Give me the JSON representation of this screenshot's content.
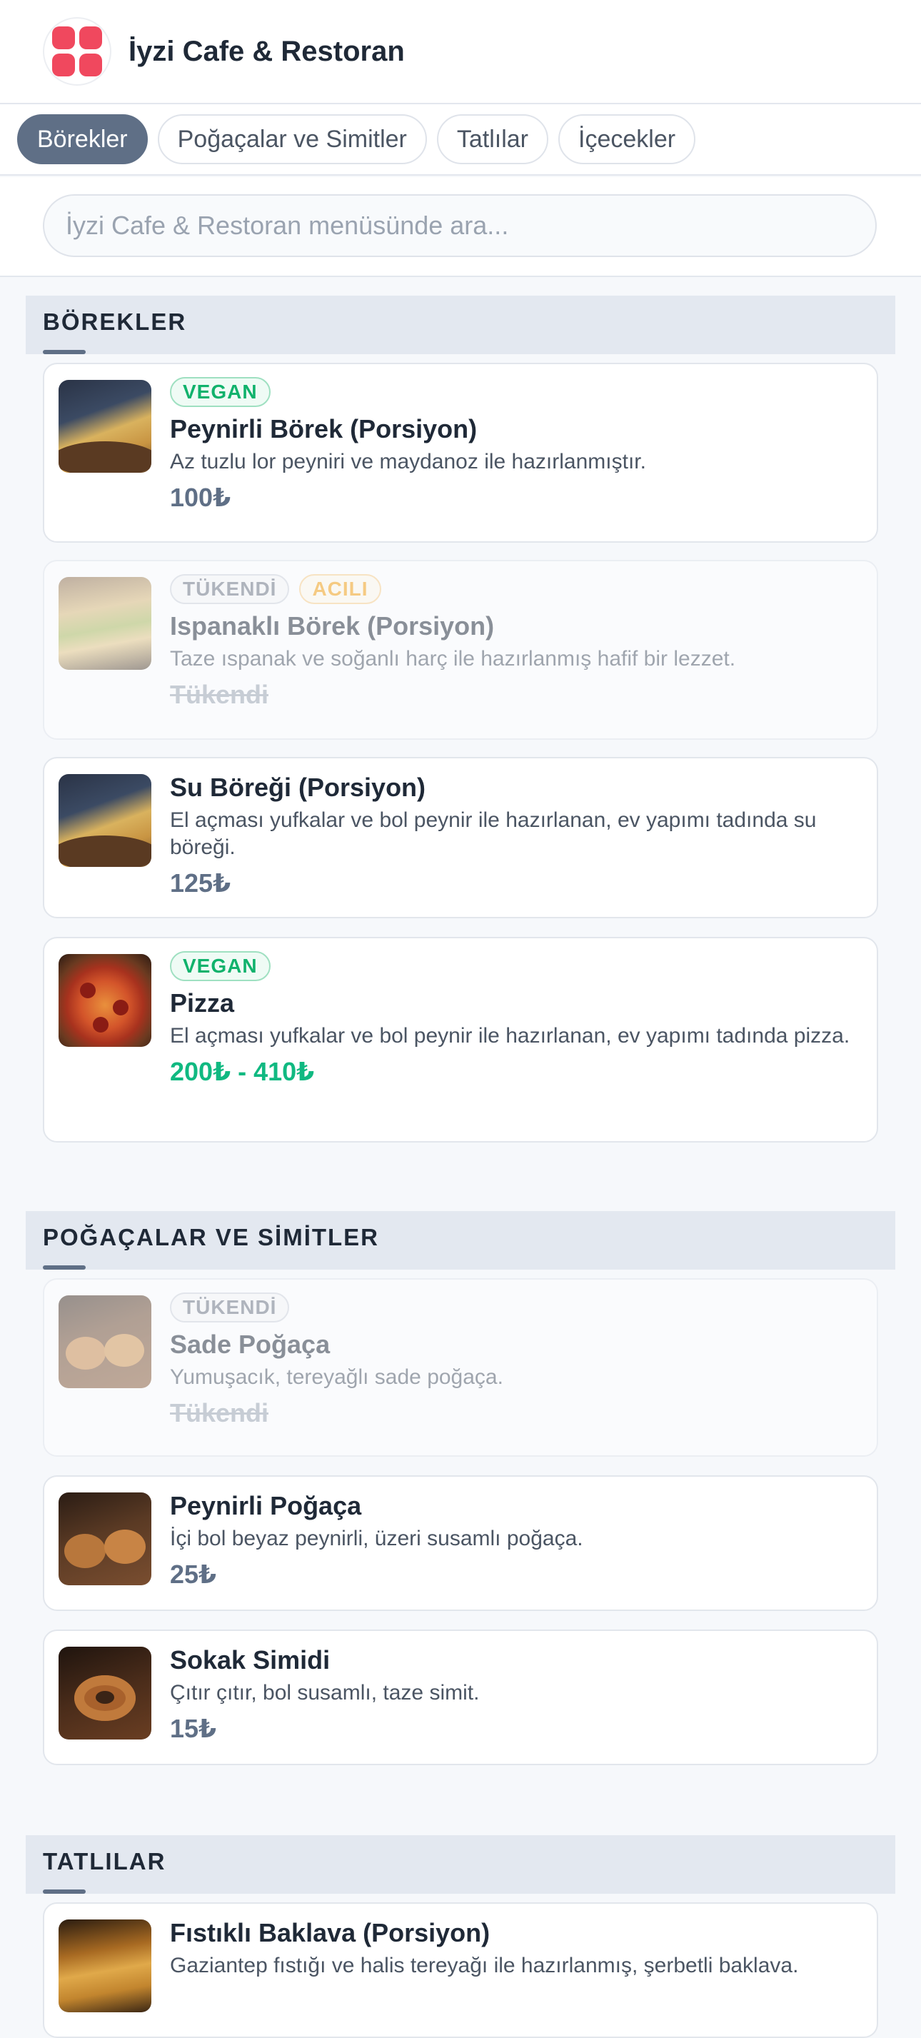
{
  "app": {
    "title": "İyzi Cafe & Restoran"
  },
  "tabs": [
    {
      "label": "Börekler",
      "active": true
    },
    {
      "label": "Poğaçalar ve Simitler",
      "active": false
    },
    {
      "label": "Tatlılar",
      "active": false
    },
    {
      "label": "İçecekler",
      "active": false
    }
  ],
  "search": {
    "placeholder": "İyzi Cafe & Restoran menüsünde ara...",
    "value": ""
  },
  "sections": [
    {
      "title": "BÖREKLER",
      "items": [
        {
          "badges": [
            "VEGAN"
          ],
          "name": "Peynirli Börek (Porsiyon)",
          "desc": "Az tuzlu lor peyniri ve maydanoz ile hazırlanmıştır.",
          "price": "100₺",
          "image": "borek-photo"
        },
        {
          "badges": [
            "TÜKENDİ",
            "ACILI"
          ],
          "name": "Ispanaklı Börek (Porsiyon)",
          "desc": "Taze ıspanak ve soğanlı harç ile hazırlanmış hafif bir lezzet.",
          "price": "Tükendi",
          "soldout": true,
          "image": "spinach-borek-photo"
        },
        {
          "badges": [],
          "name": "Su Böreği (Porsiyon)",
          "desc": "El açması yufkalar ve bol peynir ile hazırlanan, ev yapımı tadında su böreği.",
          "price": "125₺",
          "image": "borek-photo"
        },
        {
          "badges": [
            "VEGAN"
          ],
          "name": "Pizza",
          "desc": "El açması yufkalar ve bol peynir ile hazırlanan, ev yapımı tadında pizza.",
          "price": "200₺ - 410₺",
          "image": "pizza-photo"
        }
      ]
    },
    {
      "title": "POĞAÇALAR VE SİMİTLER",
      "items": [
        {
          "badges": [
            "TÜKENDİ"
          ],
          "name": "Sade Poğaça",
          "desc": "Yumuşacık, tereyağlı sade poğaça.",
          "price": "Tükendi",
          "soldout": true,
          "image": "pogaca-photo"
        },
        {
          "badges": [],
          "name": "Peynirli Poğaça",
          "desc": "İçi bol beyaz peynirli, üzeri susamlı poğaça.",
          "price": "25₺",
          "image": "pogaca-photo"
        },
        {
          "badges": [],
          "name": "Sokak Simidi",
          "desc": "Çıtır çıtır, bol susamlı, taze simit.",
          "price": "15₺",
          "image": "simit-photo"
        }
      ]
    },
    {
      "title": "TATLILAR",
      "items": [
        {
          "badges": [],
          "name": "Fıstıklı Baklava (Porsiyon)",
          "desc": "Gaziantep fıstığı ve halis tereyağı ile hazırlanmış, şerbetli baklava.",
          "price": "",
          "image": "baklava-photo"
        }
      ]
    }
  ],
  "colors": {
    "accent": "#5f6f86",
    "vegan": "#10b26c",
    "spicy": "#f59e0b",
    "price_range": "#10b981",
    "logo": "#f0485e"
  }
}
